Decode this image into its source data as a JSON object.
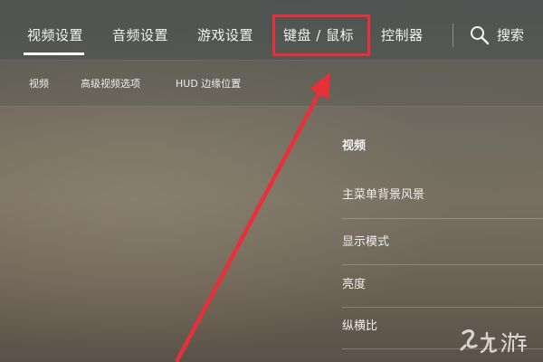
{
  "nav": {
    "tabs": [
      {
        "label": "视频设置",
        "active": true
      },
      {
        "label": "音频设置",
        "active": false
      },
      {
        "label": "游戏设置",
        "active": false
      },
      {
        "label": "键盘 / 鼠标",
        "active": false,
        "highlighted": true
      },
      {
        "label": "控制器",
        "active": false
      }
    ],
    "search": {
      "label": "搜索",
      "icon": "search-icon"
    }
  },
  "subnav": {
    "items": [
      "视频",
      "高级视频选项",
      "HUD 边缘位置"
    ]
  },
  "settings": {
    "section_title": "视频",
    "rows": [
      "主菜单背景风景",
      "显示模式",
      "亮度",
      "纵横比"
    ]
  },
  "annotation": {
    "color": "#e8303a",
    "type": "arrow-and-box",
    "target": "键盘 / 鼠标"
  },
  "watermark": {
    "logo": "九游 logo"
  }
}
